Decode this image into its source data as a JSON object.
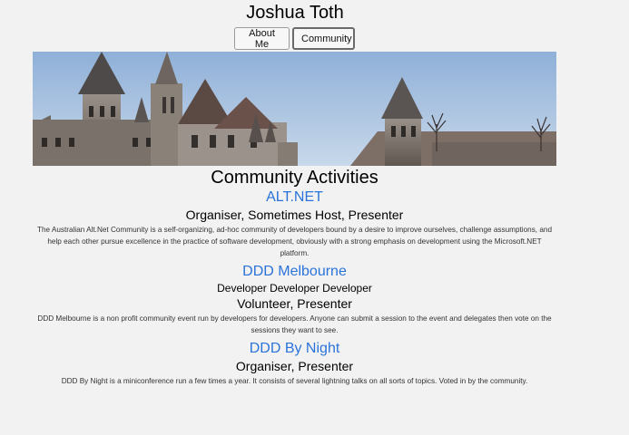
{
  "header": {
    "title": "Joshua Toth",
    "nav": [
      {
        "label": "About Me"
      },
      {
        "label": "Community"
      }
    ]
  },
  "banner": {
    "sky_color": "#9fb9d8",
    "stone_color": "#7d746c",
    "roof_color": "#5b4a44"
  },
  "main": {
    "section_title": "Community Activities",
    "activities": [
      {
        "name": "ALT.NET",
        "subtitle": "",
        "role": "Organiser, Sometimes Host, Presenter",
        "description": "The Australian Alt.Net Community is a self-organizing, ad-hoc community of developers bound by a desire to improve ourselves, challenge assumptions, and help each other pursue excellence in the practice of software development, obviously with a strong emphasis on development using the Microsoft.NET platform."
      },
      {
        "name": "DDD Melbourne",
        "subtitle": "Developer Developer Developer",
        "role": "Volunteer, Presenter",
        "description": "DDD Melbourne is a non profit community event run by developers for developers. Anyone can submit a session to the event and delegates then vote on the sessions they want to see."
      },
      {
        "name": "DDD By Night",
        "subtitle": "",
        "role": "Organiser, Presenter",
        "description": "DDD By Night is a miniconference run a few times a year. It consists of several lightning talks on all sorts of topics. Voted in by the community."
      }
    ]
  },
  "colors": {
    "link": "#2a73d9",
    "background": "#f2f2f2"
  }
}
